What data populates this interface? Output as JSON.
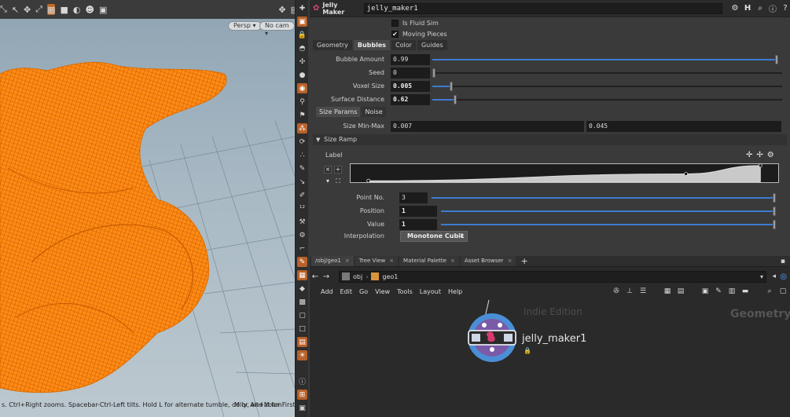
{
  "viewport": {
    "camera_mode": "Persp",
    "camera_name": "No cam",
    "status_text": "s. Ctrl+Right zooms. Spacebar-Ctrl-Left tilts. Hold L for alternate tumble, dolly, and zoom.",
    "status_text_right": "M or Alt+M for First"
  },
  "params": {
    "node_type": "Jelly Maker",
    "node_name": "jelly_maker1",
    "is_fluid_sim": {
      "label": "Is Fluid Sim",
      "checked": false
    },
    "moving_pieces": {
      "label": "Moving Pieces",
      "checked": true
    },
    "tabs": [
      {
        "label": "Geometry",
        "active": false
      },
      {
        "label": "Bubbles",
        "active": true
      },
      {
        "label": "Color",
        "active": false
      },
      {
        "label": "Guides",
        "active": false
      }
    ],
    "bubble_amount": {
      "label": "Bubble Amount",
      "value": "0.99",
      "fraction": 0.99
    },
    "seed": {
      "label": "Seed",
      "value": "0",
      "fraction": 0.0
    },
    "voxel_size": {
      "label": "Voxel Size",
      "value": "0.005",
      "fraction": 0.05
    },
    "surface_distance": {
      "label": "Surface Distance",
      "value": "0.62",
      "fraction": 0.06
    },
    "subtabs": [
      {
        "label": "Size Params",
        "active": true
      },
      {
        "label": "Noise",
        "active": false
      }
    ],
    "size_min_max": {
      "label": "Size Min-Max",
      "min": "0.007",
      "max": "0.045"
    },
    "size_ramp": {
      "title": "Size Ramp",
      "label": "Label",
      "point_no": {
        "label": "Point No.",
        "value": "3",
        "fraction": 1.0
      },
      "position": {
        "label": "Position",
        "value": "1",
        "fraction": 1.0
      },
      "value": {
        "label": "Value",
        "value": "1",
        "fraction": 1.0
      },
      "interpolation": {
        "label": "Interpolation",
        "value": "Monotone Cubic"
      },
      "points": [
        {
          "pos": 0.0,
          "val": 0.0
        },
        {
          "pos": 0.81,
          "val": 0.45
        },
        {
          "pos": 1.0,
          "val": 1.0
        }
      ]
    }
  },
  "network": {
    "tabs": [
      {
        "label": "/obj/geo1",
        "active": true
      },
      {
        "label": "Tree View",
        "active": false
      },
      {
        "label": "Material Palette",
        "active": false
      },
      {
        "label": "Asset Browser",
        "active": false
      }
    ],
    "path": [
      "obj",
      "geo1"
    ],
    "menu": [
      "Add",
      "Edit",
      "Go",
      "View",
      "Tools",
      "Layout",
      "Help"
    ],
    "watermark_edition": "Indie Edition",
    "watermark_context": "Geometry",
    "node_label": "jelly_maker1"
  },
  "colors": {
    "accent": "#c06a28",
    "slider_fill": "#3d7bd1",
    "jelly_orange": "#ff8a14",
    "node_ring": "#4a8fd6",
    "node_inner": "#7b5aa8"
  }
}
